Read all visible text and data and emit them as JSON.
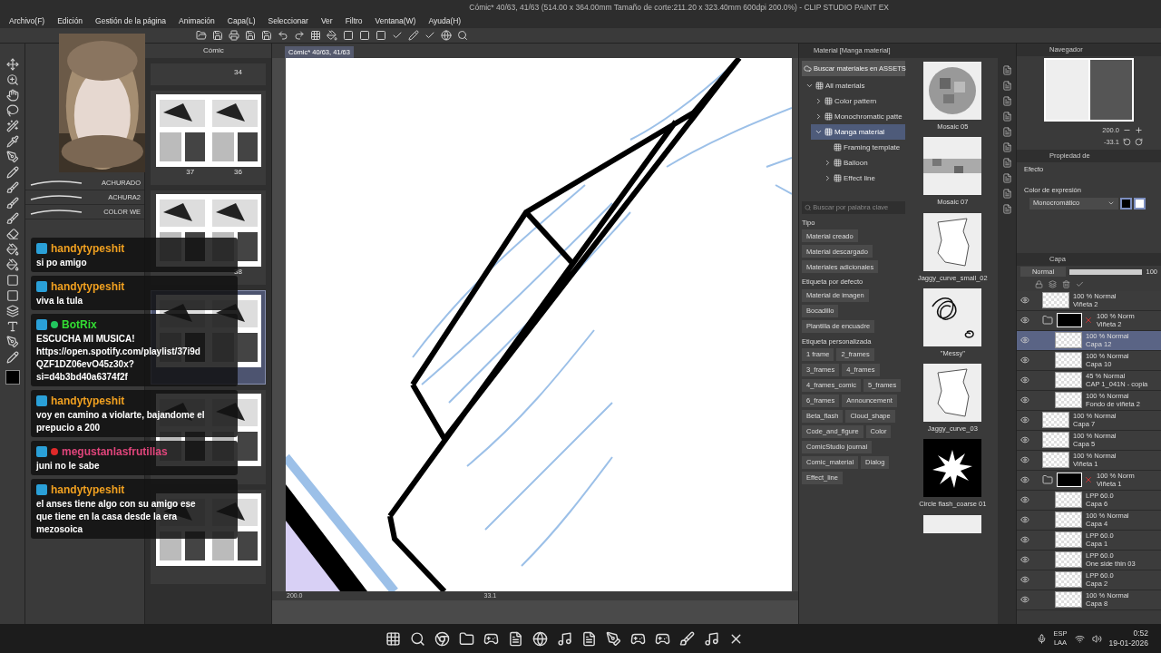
{
  "window": {
    "title": "Cómic* 40/63, 41/63 (514.00 x 364.00mm Tamaño de corte:211.20 x 323.40mm 600dpi 200.0%)  - CLIP STUDIO PAINT EX"
  },
  "menu": [
    "Archivo(F)",
    "Edición",
    "Gestión de la página",
    "Animación",
    "Capa(L)",
    "Seleccionar",
    "Ver",
    "Filtro",
    "Ventana(W)",
    "Ayuda(H)"
  ],
  "sub_tool_panel": {
    "brushes": [
      "ACHURADO",
      "ACHURA2",
      "COLOR WE"
    ]
  },
  "page_manager": {
    "tab": "Cómic",
    "spreads": [
      {
        "labels": [
          "34"
        ],
        "selected": false
      },
      {
        "labels": [
          "37",
          "36"
        ],
        "selected": false
      },
      {
        "labels": [
          "38"
        ],
        "selected": false
      },
      {
        "selected": true
      },
      {
        "selected": false
      },
      {
        "selected": false
      }
    ]
  },
  "document_tab": {
    "label": "Cómic* 40/63, 41/63",
    "selected": true
  },
  "canvas_status": {
    "zoom": "200.0",
    "angle": "33.1"
  },
  "material_panel": {
    "title": "Material [Manga material]",
    "assets_button": "Buscar materiales en ASSETS",
    "tree": [
      {
        "label": "All materials",
        "expanded": true,
        "selected": false,
        "children": [
          {
            "label": "Color pattern",
            "expanded": false,
            "selected": false
          },
          {
            "label": "Monochromatic patte",
            "expanded": false,
            "selected": false
          },
          {
            "label": "Manga material",
            "expanded": true,
            "selected": true,
            "children": [
              {
                "label": "Framing template",
                "selected": false
              },
              {
                "label": "Balloon",
                "expanded": false,
                "selected": false
              },
              {
                "label": "Effect line",
                "expanded": false,
                "selected": false
              }
            ]
          }
        ]
      }
    ],
    "search": {
      "placeholder": "Buscar por palabra clave"
    },
    "tag_groups": [
      {
        "title": "Tipo",
        "tags": [
          "Material creado",
          "Material descargado",
          "Materiales adicionales"
        ]
      },
      {
        "title": "Etiqueta por defecto",
        "tags": [
          "Material de imagen",
          "Bocadillo",
          "Plantilla de encuadre"
        ]
      },
      {
        "title": "Etiqueta personalizada",
        "tags": [
          "1 frame",
          "2_frames",
          "3_frames",
          "4_frames",
          "4_frames_comic",
          "5_frames",
          "6_frames",
          "Announcement",
          "Beta_flash",
          "Cloud_shape",
          "Code_and_figure",
          "Color",
          "ComicStudio journal",
          "Comic_material",
          "Dialog",
          "Effect_line"
        ]
      }
    ],
    "items": [
      {
        "label": "Mosaic 05",
        "kind": "mosaic"
      },
      {
        "label": "Mosaic 07",
        "kind": "band"
      },
      {
        "label": "Jaggy_curve_small_02",
        "kind": "jaggy"
      },
      {
        "label": "\"Messy\"",
        "kind": "scribble"
      },
      {
        "label": "Jaggy_curve_03",
        "kind": "jaggy"
      },
      {
        "label": "Circle flash_coarse 01",
        "kind": "flash"
      },
      {
        "kind": "blank"
      }
    ]
  },
  "navigator": {
    "title": "Navegador",
    "zoom": "200.0",
    "angle": "-33.1"
  },
  "property_panel": {
    "title": "Propiedad de",
    "effect_label": "Efecto",
    "expression_label": "Color de expresión",
    "expression_value": "Monocromático"
  },
  "layer_panel": {
    "title": "Capa",
    "blend_mode": "Normal",
    "opacity": "100",
    "opacity_slider": {
      "level": 1
    },
    "layers": [
      {
        "mode": "100 % Normal",
        "name": "Viñeta 2",
        "selected": false
      },
      {
        "mode": "100 % Norm",
        "name": "Viñeta 2",
        "kind": "folder",
        "selected": false,
        "children": [
          {
            "mode": "100 % Normal",
            "name": "Capa 12",
            "selected": true
          },
          {
            "mode": "100 % Normal",
            "name": "Capa 10",
            "selected": false
          },
          {
            "mode": "45 % Normal",
            "name": "CAP 1_041N - copia",
            "selected": false
          },
          {
            "mode": "100 % Normal",
            "name": "Fondo de viñeta 2",
            "selected": false
          }
        ]
      },
      {
        "mode": "100 % Normal",
        "name": "Capa 7",
        "selected": false
      },
      {
        "mode": "100 % Normal",
        "name": "Capa 5",
        "selected": false
      },
      {
        "mode": "100 % Normal",
        "name": "Viñeta 1",
        "selected": false
      },
      {
        "mode": "100 % Norm",
        "name": "Viñeta 1",
        "kind": "folder",
        "selected": false,
        "children": [
          {
            "mode": "LPP 60.0",
            "name": "Capa 6",
            "selected": false
          },
          {
            "mode": "100 % Normal",
            "name": "Capa 4",
            "selected": false
          },
          {
            "mode": "LPP 60.0",
            "name": "Capa 1",
            "selected": false
          },
          {
            "mode": "LPP 60.0",
            "name": "One side thin 03",
            "selected": false
          },
          {
            "mode": "LPP 60.0",
            "name": "Capa 2",
            "selected": false
          },
          {
            "mode": "100 % Normal",
            "name": "Capa 8",
            "selected": false
          }
        ]
      }
    ]
  },
  "chat": [
    {
      "user": "handytypeshit",
      "color": "#f0a020",
      "lines": [
        "si po amigo"
      ]
    },
    {
      "user": "handytypeshit",
      "color": "#f0a020",
      "lines": [
        "viva la tula"
      ]
    },
    {
      "user": "BotRix",
      "color": "#33dd33",
      "kind": "verified",
      "lines": [
        "ESCUCHA MI MUSICA!",
        "https://open.spotify.com/playlist/37i9d",
        "QZF1DZ06evO45z30x?",
        "si=d4b3bd40a6374f2f"
      ]
    },
    {
      "user": "handytypeshit",
      "color": "#f0a020",
      "lines": [
        "voy en camino a violarte, bajandome el",
        "prepucio a 200"
      ]
    },
    {
      "user": "megustanlasfrutillas",
      "color": "#e0457b",
      "kind": "dot",
      "lines": [
        "juni no le sabe"
      ]
    },
    {
      "user": "handytypeshit",
      "color": "#f0a020",
      "lines": [
        "el anses tiene algo con su amigo ese",
        "que tiene en la casa desde la era",
        "mezosoica"
      ]
    }
  ],
  "taskbar": {
    "language": "ESP",
    "layout": "LAA",
    "time": "0:52",
    "date": "19-01-2026"
  }
}
